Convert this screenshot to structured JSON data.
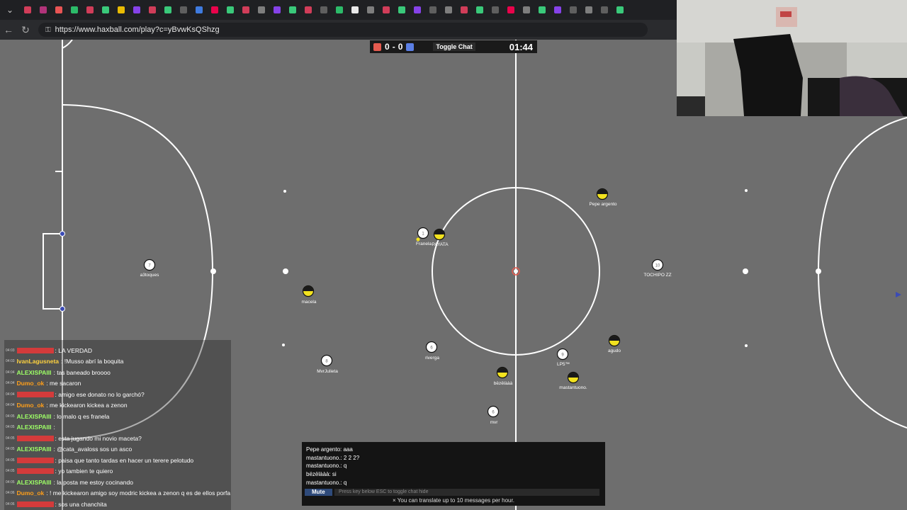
{
  "browser": {
    "url": "https://www.haxball.com/play?c=yBvwKsQShzg",
    "tab_colors": [
      "#e4405f",
      "#c13584",
      "#ff5a5a",
      "#2ecc71",
      "#e4405f",
      "#3ddc84",
      "#ffcc00",
      "#9146ff",
      "#e4405f",
      "#3ddc84",
      "#666666",
      "#4285f4",
      "#ff0050",
      "#3ddc84",
      "#e4405f",
      "#888888",
      "#9146ff",
      "#3ddc84",
      "#e4405f",
      "#666666",
      "#2ecc71",
      "#ffffff",
      "#888888",
      "#e4405f",
      "#3ddc84",
      "#9146ff",
      "#666666",
      "#888888",
      "#e4405f",
      "#3ddc84",
      "#666666",
      "#ff0050",
      "#888888",
      "#3ddc84",
      "#9146ff",
      "#666666",
      "#888888",
      "#666666",
      "#3ddc84"
    ]
  },
  "scoreboard": {
    "red_score": "0",
    "separator": "-",
    "blue_score": "0",
    "toggle_chat_label": "Toggle Chat",
    "timer": "01:44",
    "red_color": "#e55b4f",
    "blue_color": "#5b7fe5"
  },
  "players": [
    {
      "name": "a3toques",
      "number": "7",
      "team": "white"
    },
    {
      "name": "Franela",
      "number": "1",
      "team": "white"
    },
    {
      "name": "PAYATA",
      "number": "",
      "team": "yellow"
    },
    {
      "name": "Pepe argento",
      "number": "",
      "team": "yellow"
    },
    {
      "name": "TOCHIPO ZZ",
      "number": "10",
      "team": "white"
    },
    {
      "name": "macela",
      "number": "",
      "team": "yellow"
    },
    {
      "name": "MvrJulieta",
      "number": "8",
      "team": "white"
    },
    {
      "name": "riverga",
      "number": "6",
      "team": "white"
    },
    {
      "name": "bëzëlààà",
      "number": "",
      "team": "yellow"
    },
    {
      "name": "LP5™",
      "number": "9",
      "team": "white"
    },
    {
      "name": "agudo",
      "number": "",
      "team": "yellow"
    },
    {
      "name": "mastantuono.",
      "number": "",
      "team": "yellow"
    },
    {
      "name": "mvr",
      "number": "6",
      "team": "white"
    }
  ],
  "twitch_chat": [
    {
      "time": "04:03",
      "user": "",
      "user_color": "#d43b3b",
      "message": ": LA VERDAD"
    },
    {
      "time": "04:03",
      "user": "IvanLagusneta",
      "user_color": "#ffd23f",
      "message": ": !Musso abrí la boquita"
    },
    {
      "time": "04:04",
      "user": "ALEXISPAIII",
      "user_color": "#9dff66",
      "message": ": tas baneado broooo"
    },
    {
      "time": "04:04",
      "user": "Dumo_ok",
      "user_color": "#ff9f1a",
      "message": ": me sacaron"
    },
    {
      "time": "04:04",
      "user": "",
      "user_color": "#d43b3b",
      "message": ": amigo ese donato no lo garchó?"
    },
    {
      "time": "04:04",
      "user": "Dumo_ok",
      "user_color": "#ff9f1a",
      "message": ": me kickearon kickea a zenon"
    },
    {
      "time": "04:05",
      "user": "ALEXISPAIII",
      "user_color": "#9dff66",
      "message": ": lo malo q es franela"
    },
    {
      "time": "04:05",
      "user": "ALEXISPAIII",
      "user_color": "#9dff66",
      "message": ":"
    },
    {
      "time": "04:05",
      "user": "",
      "user_color": "#d43b3b",
      "message": ": esta jugando mi novio maceta?"
    },
    {
      "time": "04:05",
      "user": "ALEXISPAIII",
      "user_color": "#9dff66",
      "message": ": @cata_avaloss sos un asco"
    },
    {
      "time": "04:05",
      "user": "",
      "user_color": "#d43b3b",
      "message": ": paisa que tanto tardas en hacer un terere pelotudo"
    },
    {
      "time": "04:05",
      "user": "",
      "user_color": "#d43b3b",
      "message": ": yo tambien te quiero"
    },
    {
      "time": "04:05",
      "user": "ALEXISPAIII",
      "user_color": "#9dff66",
      "message": ": la posta me estoy cocinando"
    },
    {
      "time": "04:06",
      "user": "Dumo_ok",
      "user_color": "#ff9f1a",
      "message": ": ! me kickearon amigo soy modric kickea a zenon q es de ellos porfa"
    },
    {
      "time": "04:06",
      "user": "",
      "user_color": "#d43b3b",
      "message": ": sos una chanchita"
    }
  ],
  "ingame_chat": {
    "lines": [
      "Pepe argento: aaa",
      "mastantuono.: 2 2 2?",
      "mastantuono.: q",
      "bëzëlààà: si",
      "mastantuono.: q"
    ],
    "mute_label": "Mute",
    "input_placeholder": "Press key below ESC to toggle chat hide",
    "translate_notice": "× You can translate up to 10 messages per hour."
  }
}
